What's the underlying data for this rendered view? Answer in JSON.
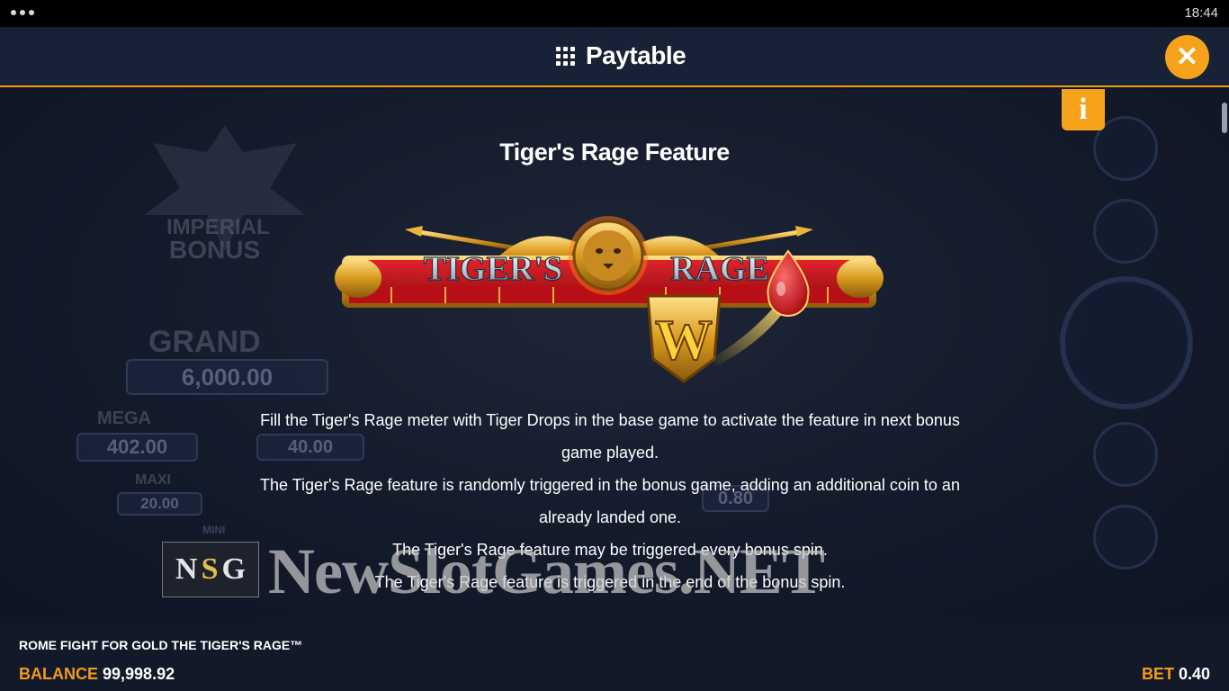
{
  "status_bar": {
    "time": "18:44"
  },
  "header": {
    "title": "Paytable",
    "menu_icon": "grid-menu-icon",
    "close_icon": "close-icon"
  },
  "info_button": {
    "label": "i"
  },
  "section": {
    "title": "Tiger's Rage Feature",
    "logo_text": {
      "word1": "TIGER'S",
      "word2": "RAGE",
      "wild": "W"
    },
    "paragraphs": [
      "Fill the Tiger's Rage meter with Tiger Drops in the base game to activate the feature in next bonus game played.",
      "The Tiger's Rage feature is randomly triggered in the bonus game, adding an additional coin to an already landed one.",
      "The Tiger's Rage feature may be triggered every bonus spin.",
      "The Tiger's Rage feature is triggered in the end of the bonus spin."
    ]
  },
  "background_scene": {
    "bonus_label_1": "IMPERIAL",
    "bonus_label_2": "BONUS",
    "jackpots": [
      {
        "name": "GRAND",
        "value": "6,000.00"
      },
      {
        "name": "MEGA",
        "value": "402.00"
      },
      {
        "name": "MAXI",
        "value": "20.00"
      },
      {
        "name": "MINI",
        "value": ""
      }
    ],
    "reel_values": [
      "40.00",
      "0.80"
    ]
  },
  "watermark": {
    "box_letters": [
      "N",
      "S",
      "G"
    ],
    "text": "NewSlotGames.NET"
  },
  "footer": {
    "game_name": "ROME FIGHT FOR GOLD THE TIGER'S RAGE™",
    "balance_label": "BALANCE",
    "balance_value": "99,998.92",
    "bet_label": "BET",
    "bet_value": "0.40"
  },
  "colors": {
    "accent": "#f39a1a",
    "header_bg": "#172236",
    "close_button": "#f6a31b"
  }
}
